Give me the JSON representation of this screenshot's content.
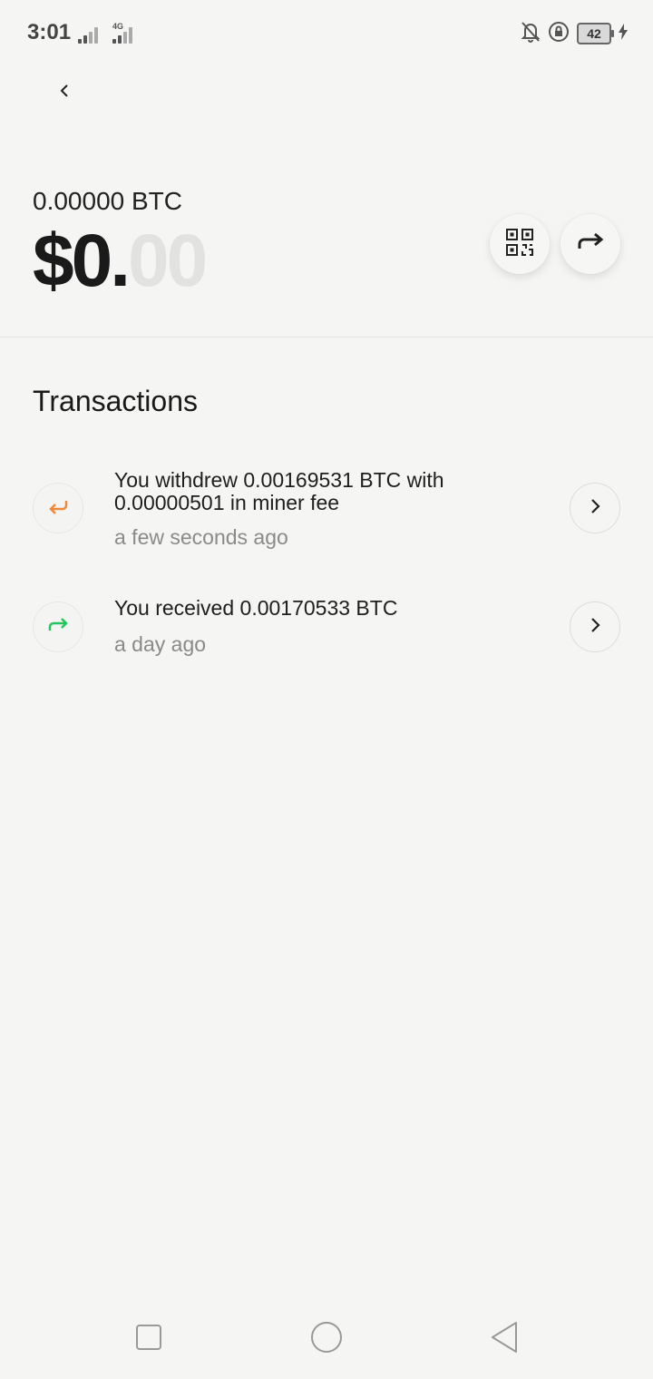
{
  "status_bar": {
    "time": "3:01",
    "network": "4G",
    "battery": "42"
  },
  "wallet": {
    "btc_balance": "0.00000 BTC",
    "usd_main": "$0.",
    "usd_cents": "00"
  },
  "transactions": {
    "heading": "Transactions",
    "items": [
      {
        "direction": "withdraw",
        "icon": "return-arrow-icon",
        "color": "#f0893c",
        "title": "You withdrew 0.00169531 BTC with 0.00000501 in miner fee",
        "time": "a few seconds ago"
      },
      {
        "direction": "receive",
        "icon": "forward-arrow-icon",
        "color": "#22c55e",
        "title": "You received 0.00170533 BTC",
        "time": "a day ago"
      }
    ]
  },
  "colors": {
    "background": "#f5f5f3",
    "text": "#1f1f1f",
    "muted": "#8a8a88"
  }
}
